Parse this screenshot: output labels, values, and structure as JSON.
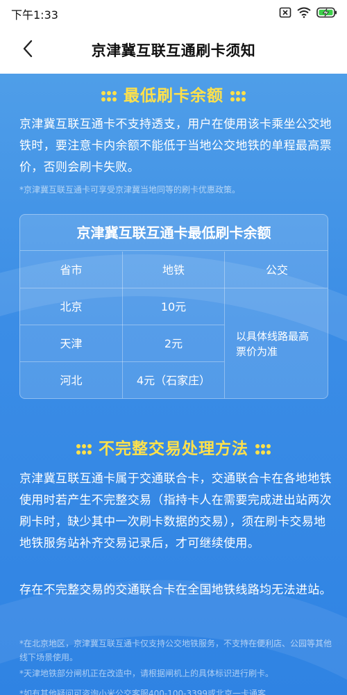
{
  "status_bar": {
    "time": "下午1:33"
  },
  "nav": {
    "title": "京津冀互联互通刷卡须知"
  },
  "section1": {
    "title": "最低刷卡余额",
    "paragraph": "京津冀互联互通卡不支持透支，用户在使用该卡乘坐公交地铁时，要注意卡内余额不能低于当地公交地铁的单程最高票价，否则会刷卡失败。",
    "note": "*京津冀互联互通卡可享受京津冀当地同等的刷卡优惠政策。"
  },
  "table": {
    "title": "京津冀互联互通卡最低刷卡余额",
    "headers": [
      "省市",
      "地铁",
      "公交"
    ],
    "rows": [
      {
        "city": "北京",
        "subway": "10元"
      },
      {
        "city": "天津",
        "subway": "2元"
      },
      {
        "city": "河北",
        "subway": "4元（石家庄）"
      }
    ],
    "bus_note": "以具体线路最高票价为准"
  },
  "section2": {
    "title": "不完整交易处理方法",
    "paragraph": "京津冀互联互通卡属于交通联合卡，交通联合卡在各地地铁使用时若产生不完整交易（指持卡人在需要完成进出站两次刷卡时，缺少其中一次刷卡数据的交易），须在刷卡交易地地铁服务站补齐交易记录后，才可继续使用。",
    "paragraph2": "存在不完整交易的交通联合卡在全国地铁线路均无法进站。",
    "notes": [
      "*在北京地区，京津冀互联互通卡仅支持公交地铁服务，不支持在便利店、公园等其他线下场景使用。",
      "*天津地铁部分闸机正在改造中，请根据闸机上的具体标识进行刷卡。",
      "*如有其他疑问可咨询小米公交客服400-100-3399或北京一卡通客"
    ]
  },
  "colors": {
    "accent_yellow": "#ffe14a",
    "background_blue": "#3b8de6"
  },
  "icons": [
    "alarm-icon",
    "wifi-icon",
    "battery-charging-icon",
    "back-chevron-icon"
  ]
}
